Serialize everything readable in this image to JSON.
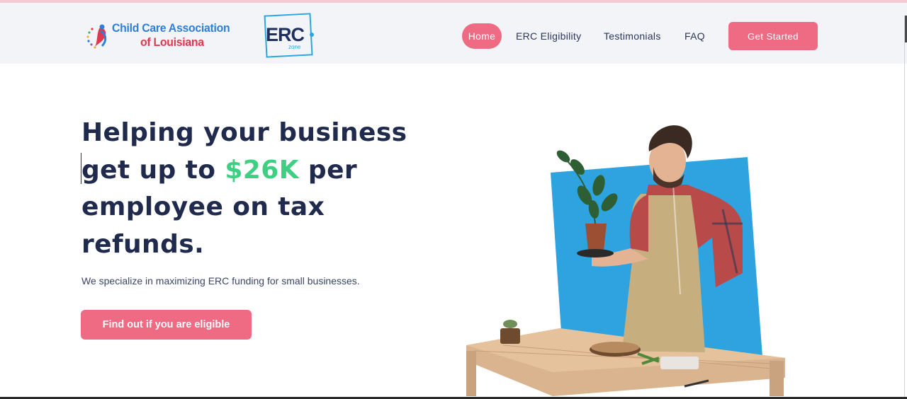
{
  "header": {
    "logo_cca": {
      "line1": "Child Care Association",
      "line2": "of Louisiana"
    },
    "logo_erc": {
      "main": "ERC",
      "sub": "zone"
    },
    "nav": [
      {
        "label": "Home",
        "active": true
      },
      {
        "label": "ERC Eligibility"
      },
      {
        "label": "Testimonials"
      },
      {
        "label": "FAQ"
      }
    ],
    "cta_label": "Get Started"
  },
  "hero": {
    "title_part1": "Helping your business get up to ",
    "title_amount": "$26K",
    "title_part2": " per employee on tax refunds.",
    "subtitle": "We specialize in maximizing ERC funding for small businesses.",
    "button_label": "Find out if you are eligible"
  },
  "colors": {
    "accent": "#ef6a83",
    "highlight": "#3fcf83",
    "heading": "#1f2a4d",
    "header_bg": "#f3f4f8",
    "image_bg": "#2ea3e0"
  },
  "icons": [
    "child-care-logo-icon",
    "erc-zone-logo-icon",
    "gardener-hero-illustration"
  ]
}
